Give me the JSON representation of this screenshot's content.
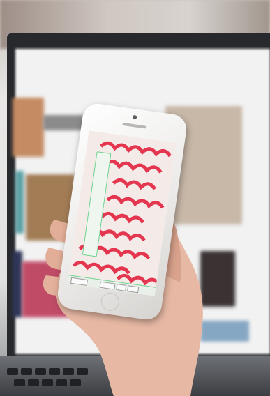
{
  "scene": {
    "description_colors": {
      "pattern_red": "#e4364f",
      "pattern_light": "#f4eae8",
      "toolbar_green": "#6fd38f"
    }
  },
  "phone_app": {
    "top_label": " ",
    "toolbar_items": [
      "",
      "",
      "",
      "",
      "",
      ""
    ],
    "bottom_buttons": [
      "",
      "",
      "",
      ""
    ]
  }
}
